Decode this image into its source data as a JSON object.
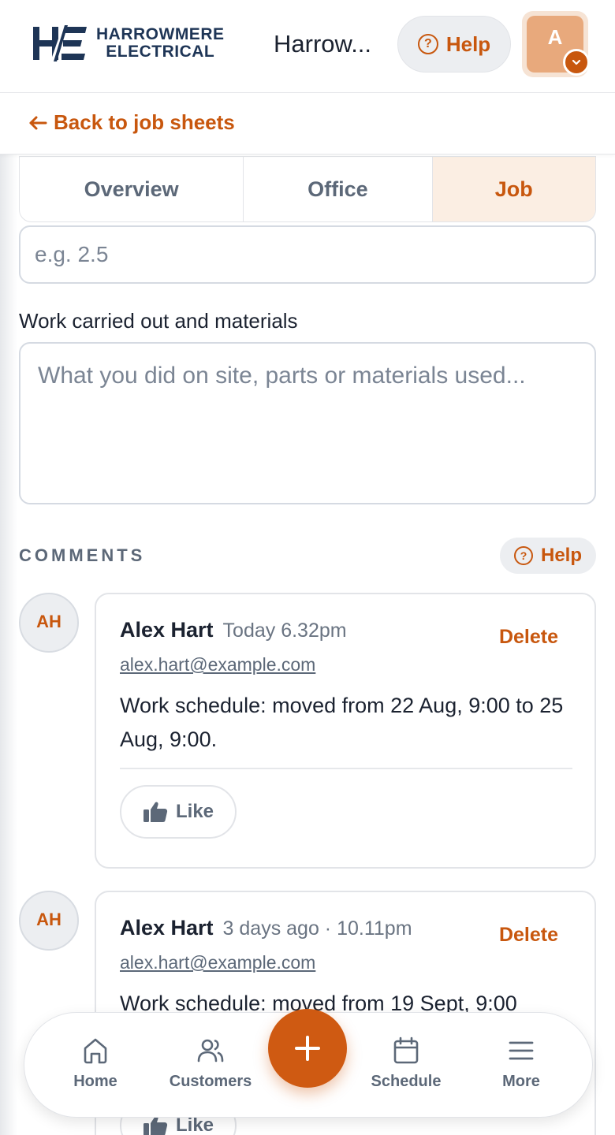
{
  "header": {
    "brand_line1": "HARROWMERE",
    "brand_line2": "ELECTRICAL",
    "company_name": "Harrow...",
    "help_label": "Help",
    "avatar_initial": "A"
  },
  "back_link": {
    "label": "Back to job sheets"
  },
  "tabs": [
    {
      "label": "Overview",
      "active": false
    },
    {
      "label": "Office",
      "active": false
    },
    {
      "label": "Job",
      "active": true
    }
  ],
  "form": {
    "hours_placeholder": "e.g. 2.5",
    "work_label": "Work carried out and materials",
    "work_placeholder": "What you did on site, parts or materials used..."
  },
  "comments": {
    "title": "COMMENTS",
    "help_label": "Help",
    "items": [
      {
        "initials": "AH",
        "author": "Alex Hart",
        "time": "Today 6.32pm",
        "email": "alex.hart@example.com",
        "text": "Work schedule: moved from 22 Aug, 9:00 to 25 Aug, 9:00.",
        "delete_label": "Delete",
        "like_label": "Like"
      },
      {
        "initials": "AH",
        "author": "Alex Hart",
        "time": "3 days ago · 10.11pm",
        "email": "alex.hart@example.com",
        "text": "Work schedule: moved from 19 Sept, 9:00",
        "delete_label": "Delete",
        "like_label": "Like"
      }
    ]
  },
  "bottom_nav": {
    "items": [
      {
        "label": "Home",
        "icon": "home-icon"
      },
      {
        "label": "Customers",
        "icon": "users-icon"
      },
      {
        "label": "Schedule",
        "icon": "calendar-icon"
      },
      {
        "label": "More",
        "icon": "menu-icon"
      }
    ],
    "fab_icon": "plus-icon"
  },
  "colors": {
    "accent": "#c8570e",
    "brand_navy": "#1e3556",
    "active_tab_bg": "#fbeee3",
    "muted_text": "#5c6878"
  }
}
